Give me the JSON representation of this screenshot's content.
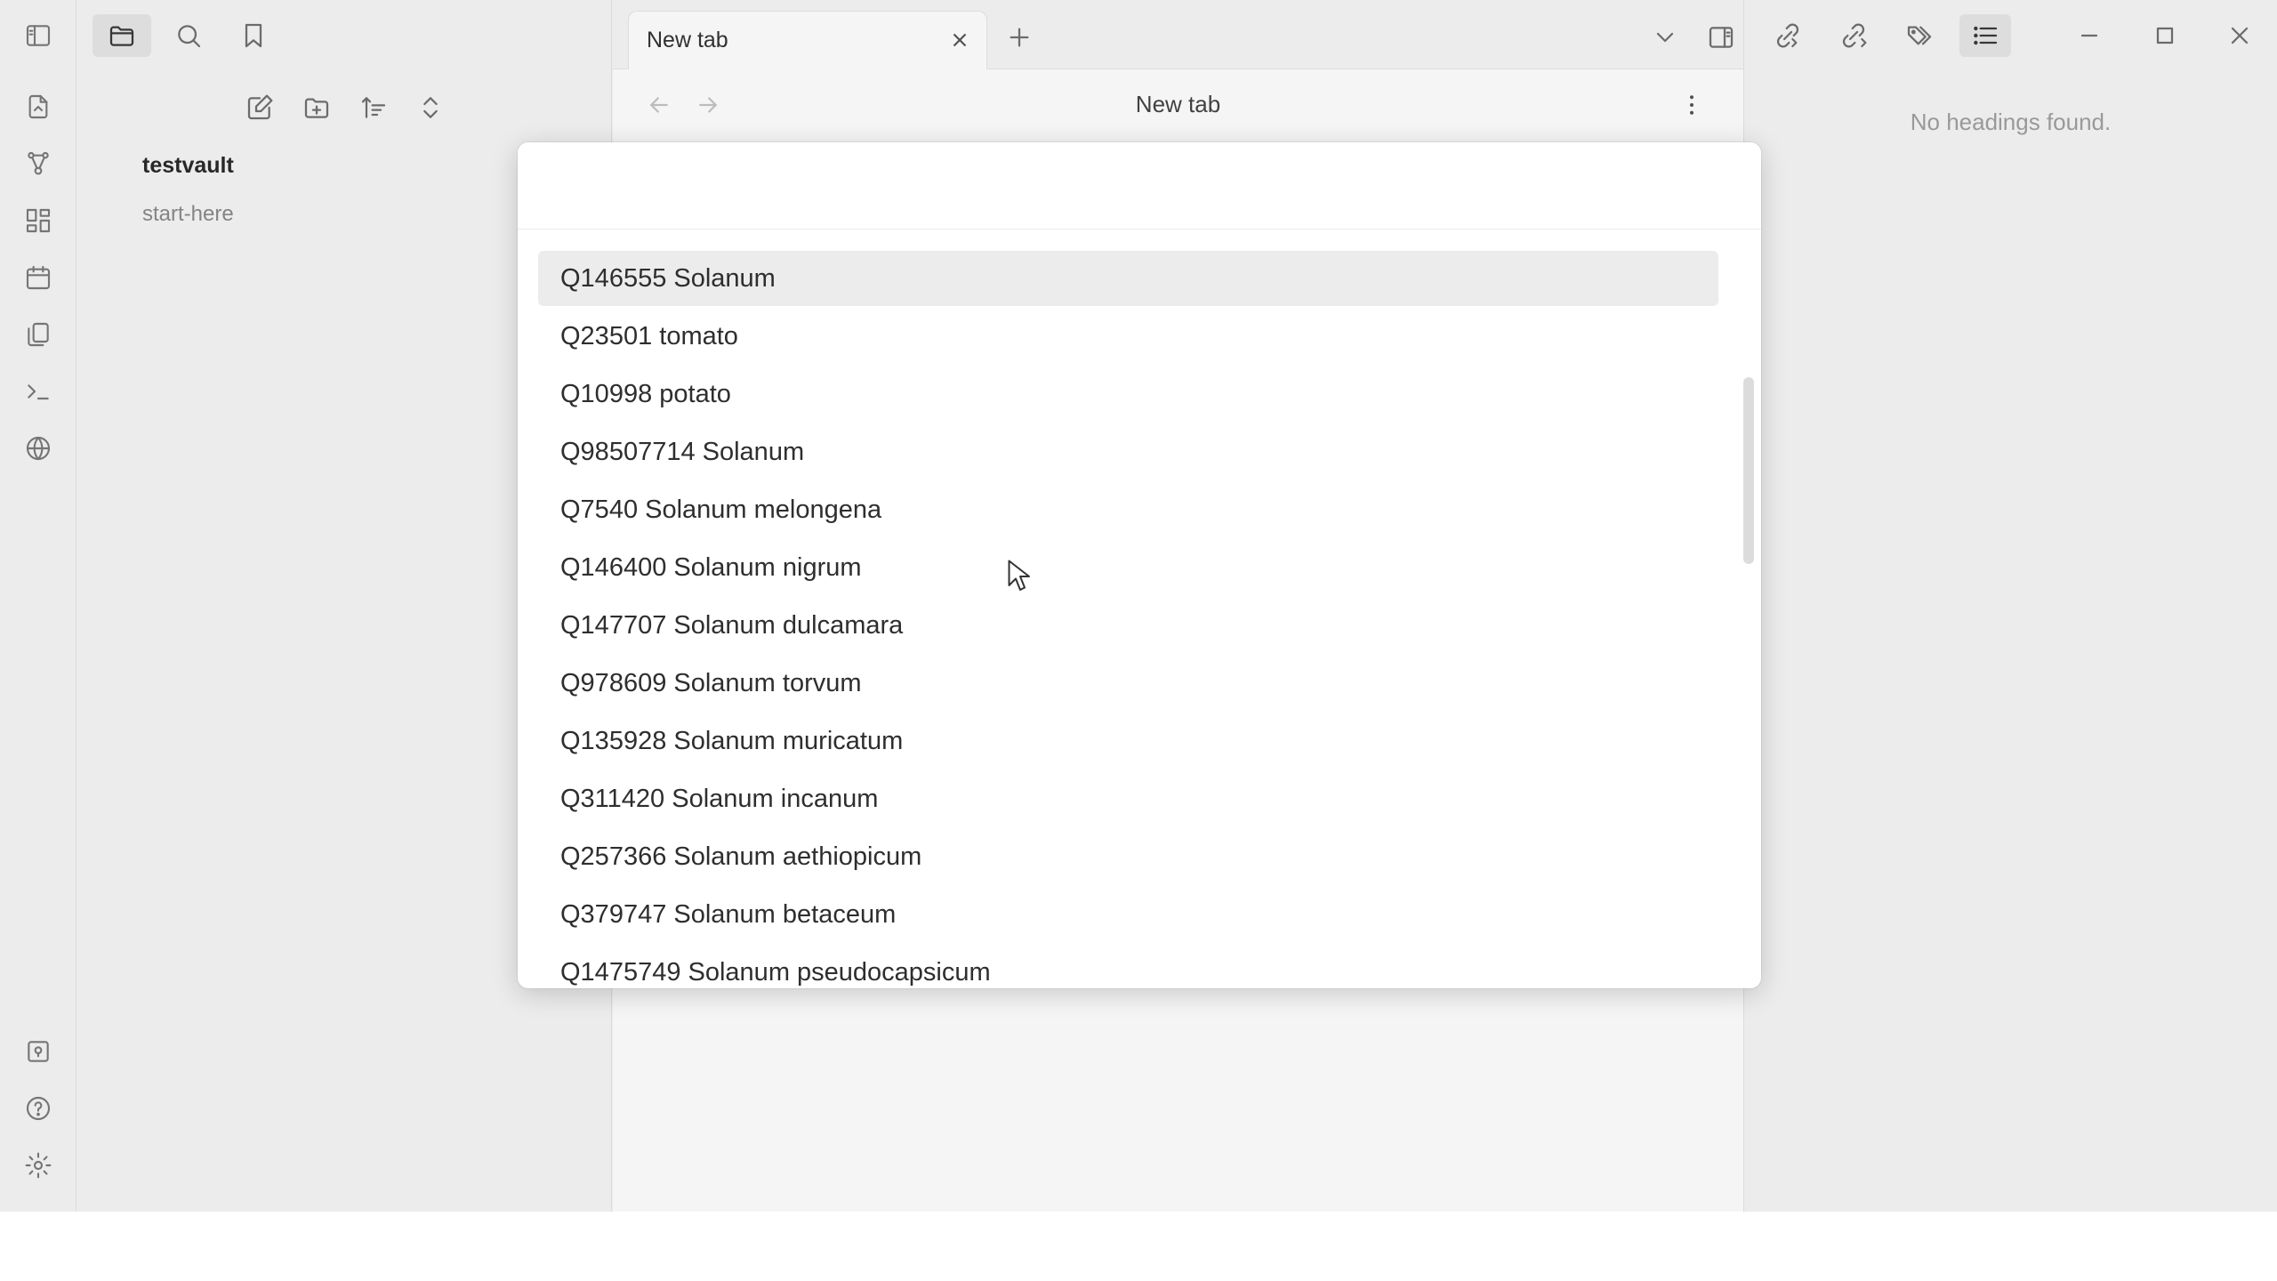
{
  "ribbon": {
    "items": [
      {
        "name": "open-quick-switcher-icon"
      },
      {
        "name": "graph-view-icon"
      },
      {
        "name": "canvas-icon"
      },
      {
        "name": "daily-note-icon"
      },
      {
        "name": "templates-icon"
      },
      {
        "name": "command-palette-icon"
      },
      {
        "name": "publish-icon"
      }
    ],
    "bottom": [
      {
        "name": "vault-switch-icon"
      },
      {
        "name": "help-icon"
      },
      {
        "name": "settings-icon"
      }
    ]
  },
  "sidebar": {
    "vault_name": "testvault",
    "files": [
      "start-here"
    ]
  },
  "main": {
    "tab_title": "New tab",
    "view_title": "New tab"
  },
  "right_sidebar": {
    "outline_empty": "No headings found."
  },
  "switcher": {
    "query": "",
    "results": [
      "Q146555 Solanum",
      "Q23501 tomato",
      "Q10998 potato",
      "Q98507714 Solanum",
      "Q7540 Solanum melongena",
      "Q146400 Solanum nigrum",
      "Q147707 Solanum dulcamara",
      "Q978609 Solanum torvum",
      "Q135928 Solanum muricatum",
      "Q311420 Solanum incanum",
      "Q257366 Solanum aethiopicum",
      "Q379747 Solanum betaceum",
      "Q1475749 Solanum pseudocapsicum"
    ],
    "selected_index": 0
  },
  "colors": {
    "background": "#f6f6f6",
    "selected_row": "#ececec",
    "muted_text": "#a0a0a0"
  }
}
